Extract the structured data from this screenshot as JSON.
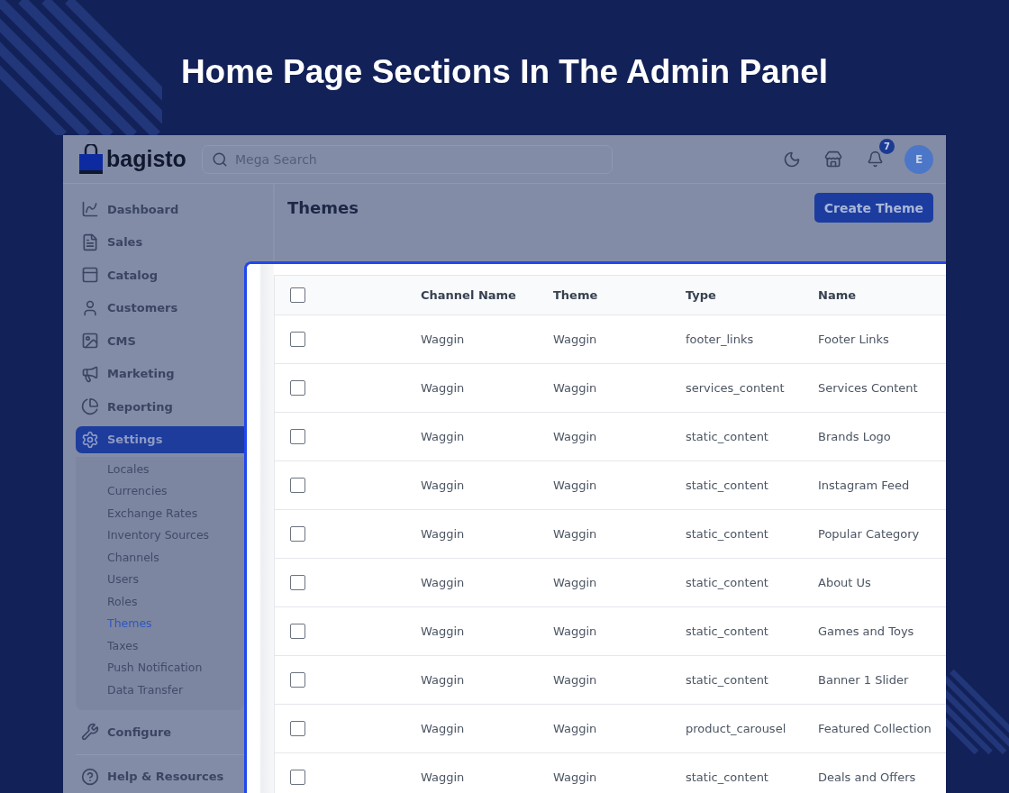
{
  "headline": "Home Page Sections In The Admin Panel",
  "header": {
    "logo": "bagisto",
    "search": {
      "placeholder": "Mega Search"
    },
    "notification_count": "7",
    "avatar": "E"
  },
  "sidebar": {
    "items": [
      {
        "label": "Dashboard",
        "selected": false
      },
      {
        "label": "Sales",
        "selected": false
      },
      {
        "label": "Catalog",
        "selected": false
      },
      {
        "label": "Customers",
        "selected": false
      },
      {
        "label": "CMS",
        "selected": false
      },
      {
        "label": "Marketing",
        "selected": false
      },
      {
        "label": "Reporting",
        "selected": false
      },
      {
        "label": "Settings",
        "selected": true,
        "expanded": true,
        "children": [
          {
            "label": "Locales",
            "selected": false
          },
          {
            "label": "Currencies",
            "selected": false
          },
          {
            "label": "Exchange Rates",
            "selected": false
          },
          {
            "label": "Inventory Sources",
            "selected": false
          },
          {
            "label": "Channels",
            "selected": false
          },
          {
            "label": "Users",
            "selected": false
          },
          {
            "label": "Roles",
            "selected": false
          },
          {
            "label": "Themes",
            "selected": true
          },
          {
            "label": "Taxes",
            "selected": false
          },
          {
            "label": "Push Notification",
            "selected": false
          },
          {
            "label": "Data Transfer",
            "selected": false
          }
        ]
      },
      {
        "label": "Configure",
        "selected": false
      },
      {
        "label": "Help & Resources",
        "selected": false
      }
    ]
  },
  "page": {
    "title": "Themes",
    "create_button": "Create Theme"
  },
  "table": {
    "select_all": {
      "checked": false
    },
    "columns": [
      "Channel Name",
      "Theme",
      "Type",
      "Name"
    ],
    "rows": [
      {
        "checked": false,
        "cells": [
          "Waggin",
          "Waggin",
          "footer_links",
          "Footer Links"
        ]
      },
      {
        "checked": false,
        "cells": [
          "Waggin",
          "Waggin",
          "services_content",
          "Services Content"
        ]
      },
      {
        "checked": false,
        "cells": [
          "Waggin",
          "Waggin",
          "static_content",
          "Brands Logo"
        ]
      },
      {
        "checked": false,
        "cells": [
          "Waggin",
          "Waggin",
          "static_content",
          "Instagram Feed"
        ]
      },
      {
        "checked": false,
        "cells": [
          "Waggin",
          "Waggin",
          "static_content",
          "Popular Category"
        ]
      },
      {
        "checked": false,
        "cells": [
          "Waggin",
          "Waggin",
          "static_content",
          "About Us"
        ]
      },
      {
        "checked": false,
        "cells": [
          "Waggin",
          "Waggin",
          "static_content",
          "Games and Toys"
        ]
      },
      {
        "checked": false,
        "cells": [
          "Waggin",
          "Waggin",
          "static_content",
          "Banner 1 Slider"
        ]
      },
      {
        "checked": false,
        "cells": [
          "Waggin",
          "Waggin",
          "product_carousel",
          "Featured Collection"
        ]
      },
      {
        "checked": false,
        "cells": [
          "Waggin",
          "Waggin",
          "static_content",
          "Deals and Offers"
        ]
      }
    ]
  }
}
